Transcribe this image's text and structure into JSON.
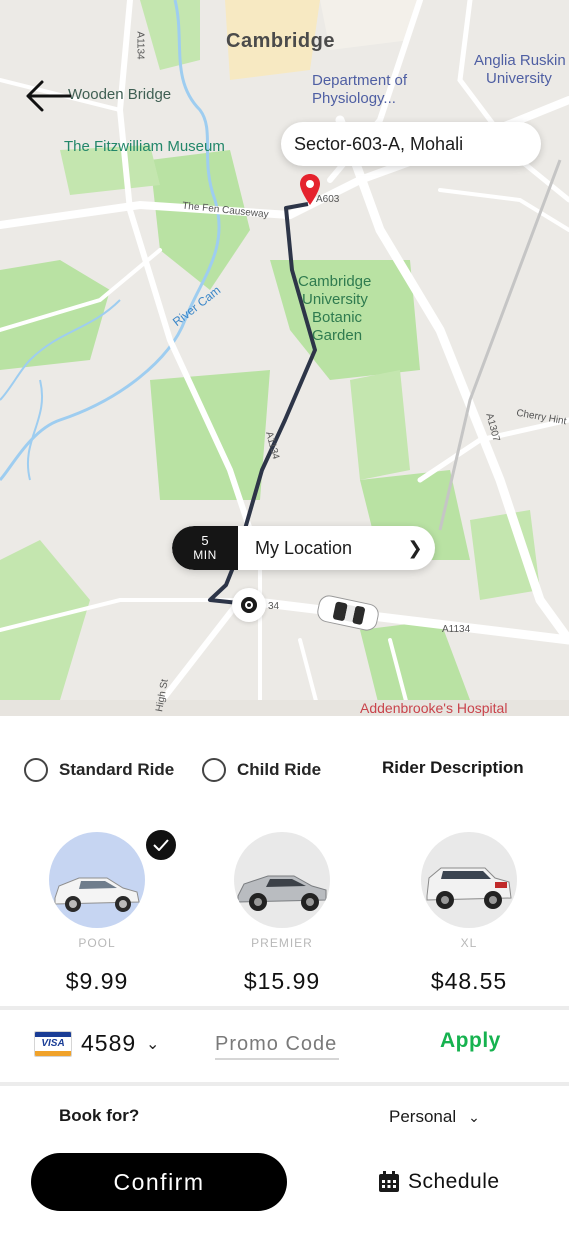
{
  "map": {
    "city_label": "Cambridge",
    "labels": {
      "wooden_bridge": "Wooden Bridge",
      "fitzwilliam": "The Fitzwilliam Museum",
      "dept_physiology_1": "Department of",
      "dept_physiology_2": "Physiology...",
      "anglia_1": "Anglia Ruskin",
      "anglia_2": "University",
      "botanic_1": "Cambridge",
      "botanic_2": "University",
      "botanic_3": "Botanic",
      "botanic_4": "Garden",
      "fen_causeway": "The Fen Causeway",
      "river_cam": "River Cam",
      "cherry_hinton": "Cherry Hint",
      "a1134_top": "A1134",
      "a1134_mid": "A1134",
      "a1134_bottom": "A1134",
      "a1307": "A1307",
      "a603": "A603",
      "road_34": "34",
      "hills_rd": "High St",
      "addenbrookes": "Addenbrooke's Hospital"
    },
    "destination": "Sector-603-A, Mohali",
    "eta": {
      "value": "5",
      "unit": "MIN",
      "location": "My Location"
    }
  },
  "ride_options": {
    "standard": "Standard Ride",
    "child": "Child Ride",
    "rider_description": "Rider Description"
  },
  "cars": [
    {
      "name": "POOL",
      "price": "$9.99",
      "selected": true
    },
    {
      "name": "PREMIER",
      "price": "$15.99",
      "selected": false
    },
    {
      "name": "XL",
      "price": "$48.55",
      "selected": false
    }
  ],
  "payment": {
    "card_brand": "VISA",
    "card_last4": "4589",
    "promo_placeholder": "Promo Code",
    "apply_label": "Apply"
  },
  "booking": {
    "book_for_label": "Book for?",
    "book_for_value": "Personal"
  },
  "actions": {
    "confirm_label": "Confirm",
    "schedule_label": "Schedule"
  },
  "colors": {
    "accent_green": "#16b24f",
    "route": "#2d3548",
    "pin_red": "#e5222d",
    "selected_car_bg": "#c6d5f2"
  }
}
